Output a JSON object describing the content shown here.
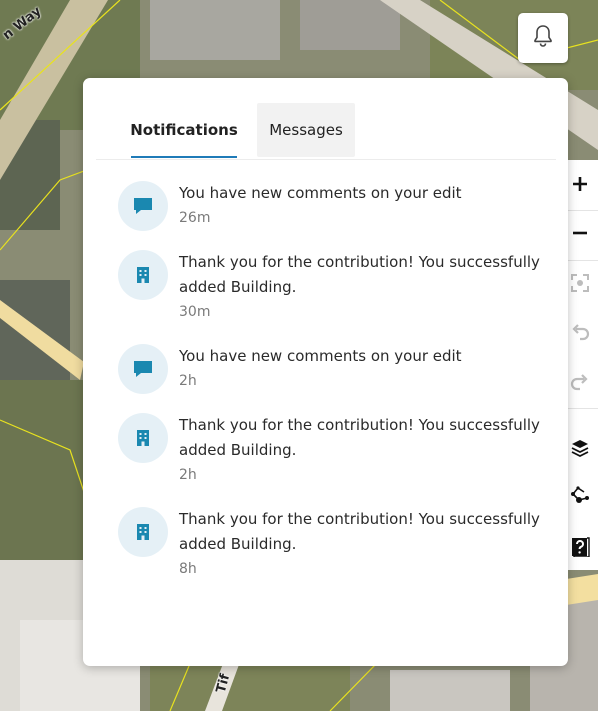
{
  "map": {
    "street_label_1": "n Way",
    "street_label_2": "Tif"
  },
  "header": {
    "bell_icon": "bell-icon"
  },
  "tabs": [
    {
      "label": "Notifications",
      "active": true
    },
    {
      "label": "Messages",
      "active": false
    }
  ],
  "notifications": [
    {
      "type": "comment",
      "icon": "comment-icon",
      "text": "You have new comments on your edit",
      "time": "26m"
    },
    {
      "type": "building",
      "icon": "building-icon",
      "text": "Thank you for the contribution! You successfully added Building.",
      "time": "30m"
    },
    {
      "type": "comment",
      "icon": "comment-icon",
      "text": "You have new comments on your edit",
      "time": "2h"
    },
    {
      "type": "building",
      "icon": "building-icon",
      "text": "Thank you for the contribution! You successfully added Building.",
      "time": "2h"
    },
    {
      "type": "building",
      "icon": "building-icon",
      "text": "Thank you for the contribution! You successfully added Building.",
      "time": "8h"
    }
  ],
  "toolbar": [
    {
      "name": "zoom-in",
      "icon": "plus-icon"
    },
    {
      "name": "zoom-out",
      "icon": "minus-icon"
    },
    {
      "name": "locate",
      "icon": "locate-icon"
    },
    {
      "name": "undo",
      "icon": "undo-icon"
    },
    {
      "name": "redo",
      "icon": "redo-icon"
    },
    {
      "name": "layers",
      "icon": "layers-icon"
    },
    {
      "name": "edit-shape",
      "icon": "node-edit-icon"
    },
    {
      "name": "help",
      "icon": "help-icon"
    }
  ],
  "colors": {
    "accent": "#1f7bb8",
    "icon_teal": "#1a88b0",
    "icon_bg": "#e5f0f6",
    "tab_underline": "#1f7bb8"
  }
}
